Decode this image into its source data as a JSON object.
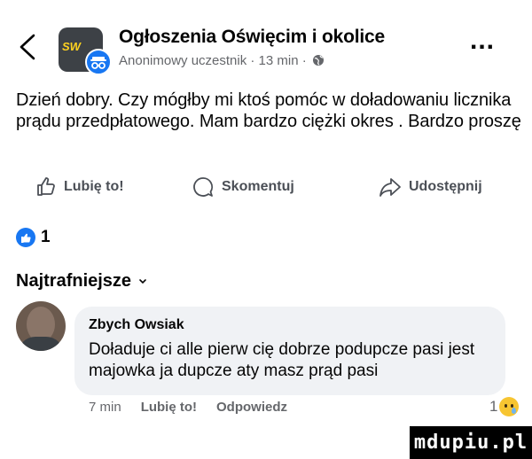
{
  "header": {
    "group_name": "Ogłoszenia Oświęcim i okolice",
    "meta": "Anonimowy uczestnik · 13 min ·",
    "more_label": "...",
    "icons": {
      "back": "chevron-left-icon",
      "privacy": "globe-icon",
      "badge": "anonymous-icon"
    },
    "group_avatar_text": "SW"
  },
  "post": {
    "text": "Dzień dobry.  Czy mógłby mi ktoś pomóc w doładowaniu licznika prądu przedpłatowego. Mam bardzo ciężki okres . Bardzo proszę"
  },
  "actions": {
    "like_label": "Lubię to!",
    "comment_label": "Skomentuj",
    "share_label": "Udostępnij"
  },
  "reactions": {
    "count": "1",
    "icon": "like-icon"
  },
  "comments": {
    "sort_label": "Najtrafniejsze",
    "items": [
      {
        "author": "Zbych Owsiak",
        "text": "Doładuje ci alle pierw cię dobrze podupcze pasi jest majowka ja dupcze aty masz prąd pasi",
        "time": "7 min",
        "like_label": "Lubię to!",
        "reply_label": "Odpowiedz",
        "reaction_count": "1",
        "reaction_icon": "sad-emoji-icon"
      }
    ]
  },
  "watermark": "mdupiu.pl",
  "colors": {
    "accent": "#1877f2",
    "secondary_text": "#65676b",
    "bubble": "#f0f2f5"
  }
}
